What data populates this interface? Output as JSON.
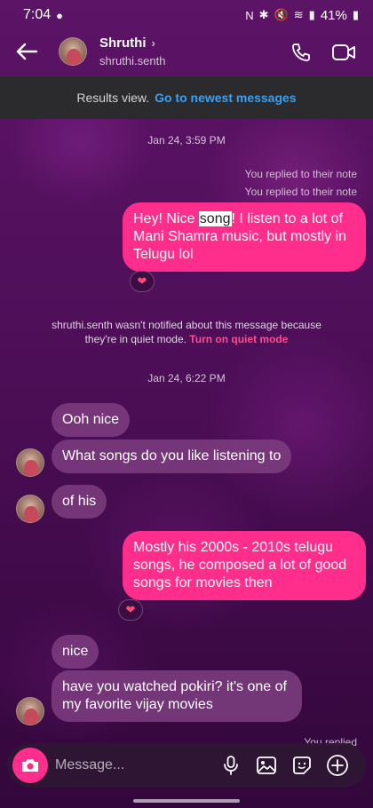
{
  "status": {
    "time": "7:04",
    "battery": "41%"
  },
  "header": {
    "name": "Shruthi",
    "handle": "shruthi.senth"
  },
  "results": {
    "label": "Results view.",
    "link": "Go to newest messages"
  },
  "messages": {
    "ts1": "Jan 24, 3:59 PM",
    "reply_note_1": "You replied to their note",
    "reply_note_2": "You replied to their note",
    "out1_a": "Hey! Nice ",
    "out1_highlight": "song",
    "out1_b": "! I listen to a lot of Mani Shamra music, but mostly in Telugu lol",
    "notice": "shruthi.senth wasn't notified about this message because they're in quiet mode.",
    "notice_link": "Turn on quiet mode",
    "ts2": "Jan 24, 6:22 PM",
    "in1": "Ooh nice",
    "in2": "What songs do you like listening to",
    "in3": "of his",
    "out2": "Mostly his 2000s - 2010s telugu songs, he composed a lot of good songs for movies then",
    "in4": "nice",
    "in5": "have you watched pokiri? it's one of my favorite vijay movies",
    "reply_note_3": "You replied"
  },
  "composer": {
    "placeholder": "Message..."
  },
  "colors": {
    "outgoing_bubble": "#ff2e8c",
    "link_blue": "#3aa0f2",
    "quiet_mode_link": "#ff4d8d"
  }
}
